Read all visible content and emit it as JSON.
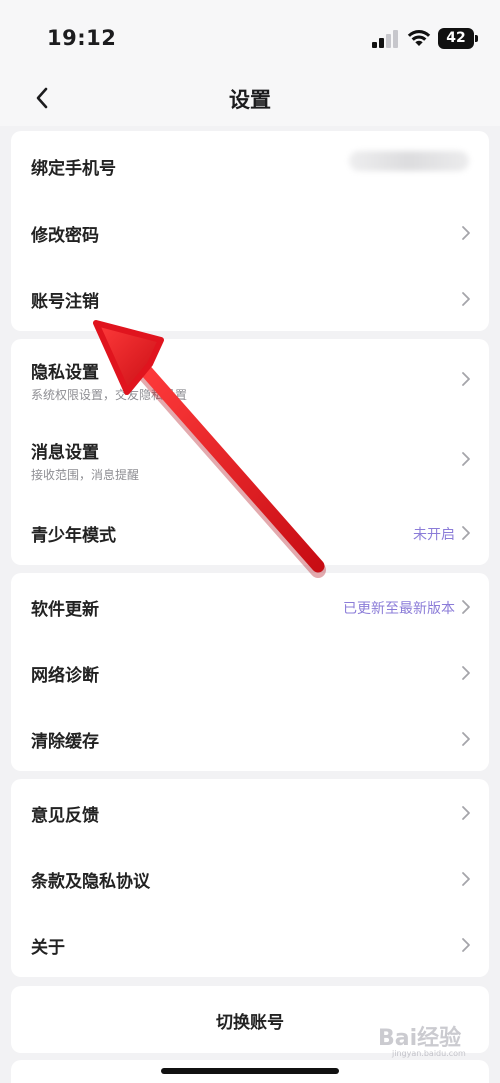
{
  "status_bar": {
    "time": "19:12",
    "battery": "42"
  },
  "header": {
    "title": "设置"
  },
  "account": {
    "bind_phone": "绑定手机号",
    "change_password": "修改密码",
    "delete_account": "账号注销"
  },
  "privacy_group": {
    "privacy": {
      "label": "隐私设置",
      "sub": "系统权限设置，交友隐私设置"
    },
    "message": {
      "label": "消息设置",
      "sub": "接收范围，消息提醒"
    },
    "teen_mode": {
      "label": "青少年模式",
      "value": "未开启"
    }
  },
  "system_group": {
    "update": {
      "label": "软件更新",
      "value": "已更新至最新版本"
    },
    "network": "网络诊断",
    "cache": "清除缓存"
  },
  "about_group": {
    "feedback": "意见反馈",
    "terms": "条款及隐私协议",
    "about": "关于"
  },
  "switch_account": "切换账号",
  "watermark": {
    "text": "Bai经验",
    "sub": "jingyan.baidu.com"
  },
  "colors": {
    "accent_text": "#8b7cd8",
    "arrow": "#e0141e",
    "background": "#f2f2f4"
  }
}
